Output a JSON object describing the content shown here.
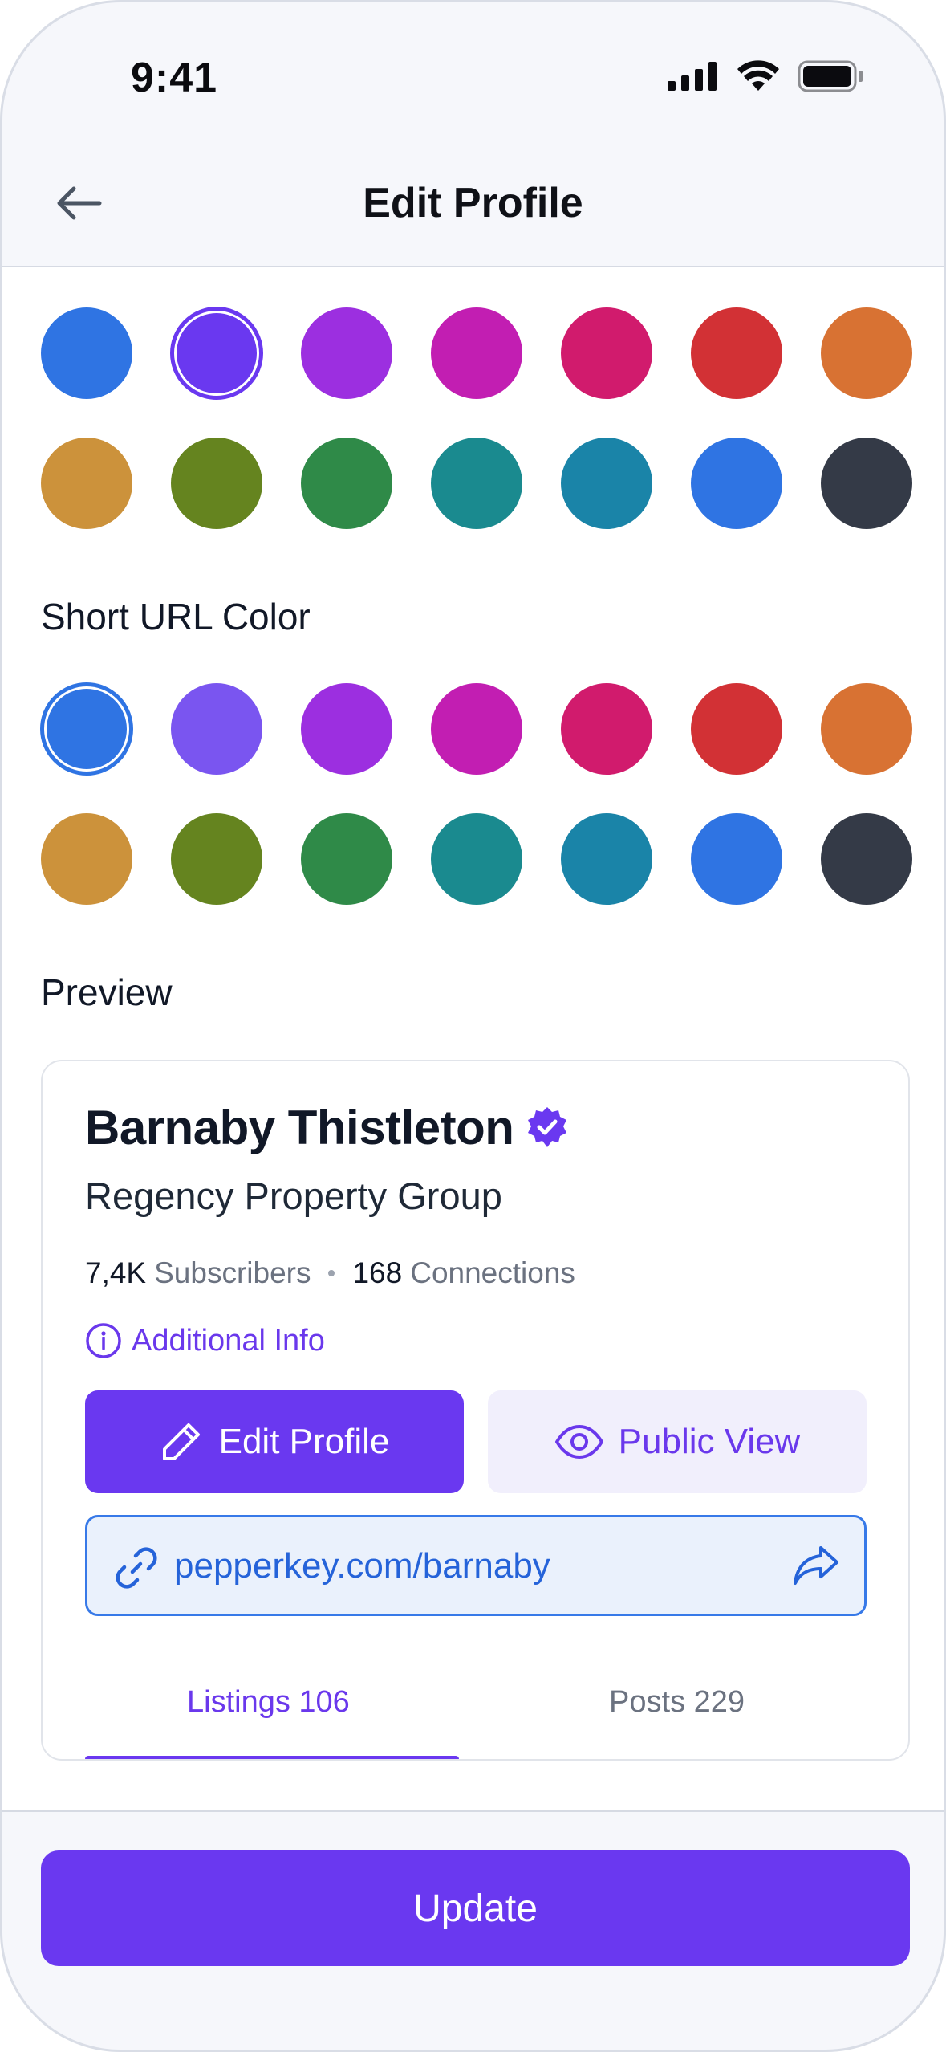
{
  "status_bar": {
    "time": "9:41"
  },
  "header": {
    "title": "Edit Profile"
  },
  "accent_colors": {
    "row1": [
      "#2f74e3",
      "#6a38f0",
      "#9c2fe0",
      "#c21eb2",
      "#d11b6d",
      "#d23135",
      "#d87233"
    ],
    "row2": [
      "#cc923b",
      "#65841f",
      "#2f8a48",
      "#1a8a8f",
      "#1a84a8",
      "#2f74e3",
      "#343a47"
    ],
    "selected": "#6a38f0"
  },
  "short_url_color": {
    "label": "Short URL Color",
    "row1": [
      "#2f74e3",
      "#7a55f0",
      "#9c2fe0",
      "#c21eb2",
      "#d11b6d",
      "#d23135",
      "#d87233"
    ],
    "row2": [
      "#cc923b",
      "#65841f",
      "#2f8a48",
      "#1a8a8f",
      "#1a84a8",
      "#2f74e3",
      "#343a47"
    ],
    "selected": "#2f74e3"
  },
  "preview": {
    "label": "Preview",
    "name": "Barnaby Thistleton",
    "company": "Regency Property Group",
    "subscribers_count": "7,4K",
    "subscribers_label": "Subscribers",
    "connections_count": "168",
    "connections_label": "Connections",
    "additional_info": "Additional Info",
    "edit_profile_label": "Edit Profile",
    "public_view_label": "Public View",
    "url": "pepperkey.com/barnaby",
    "tabs": [
      {
        "label": "Listings 106",
        "active": true
      },
      {
        "label": "Posts 229",
        "active": false
      }
    ]
  },
  "update_label": "Update"
}
